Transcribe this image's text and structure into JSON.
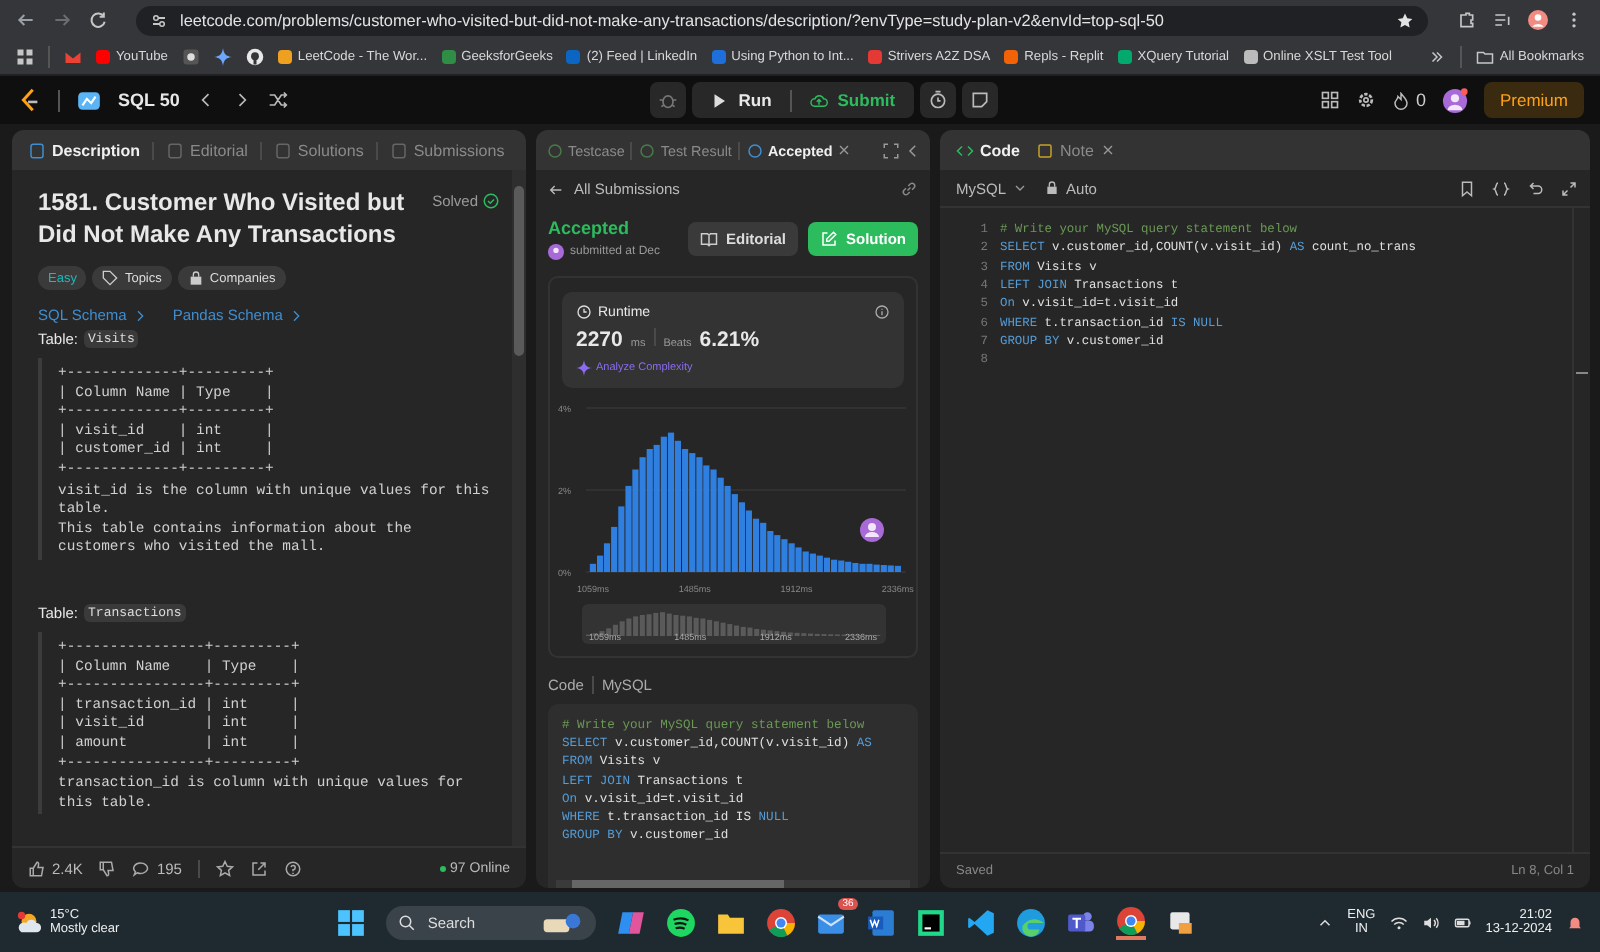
{
  "browser": {
    "url": "leetcode.com/problems/customer-who-visited-but-did-not-make-any-transactions/description/?envType=study-plan-v2&envId=top-sql-50",
    "bookmarks": [
      {
        "label": "YouTube",
        "color": "#ff0000"
      },
      {
        "label": "LeetCode - The Wor...",
        "color": "#f0a020"
      },
      {
        "label": "GeeksforGeeks",
        "color": "#2f8d46"
      },
      {
        "label": "(2) Feed | LinkedIn",
        "color": "#0a66c2"
      },
      {
        "label": "Using Python to Int...",
        "color": "#1e6fd9"
      },
      {
        "label": "Strivers A2Z DSA",
        "color": "#e53935"
      },
      {
        "label": "Repls - Replit",
        "color": "#f26207"
      },
      {
        "label": "XQuery Tutorial",
        "color": "#04aa6d"
      },
      {
        "label": "Online XSLT Test Tool",
        "color": "#bbbbbb"
      }
    ],
    "all_bookmarks": "All Bookmarks"
  },
  "nav": {
    "title": "SQL 50",
    "run": "Run",
    "submit": "Submit",
    "streak": "0",
    "premium": "Premium"
  },
  "left_panel": {
    "tabs": [
      {
        "label": "Description",
        "selected": true
      },
      {
        "label": "Editorial",
        "selected": false
      },
      {
        "label": "Solutions",
        "selected": false
      },
      {
        "label": "Submissions",
        "selected": false
      }
    ],
    "title": "1581. Customer Who Visited but Did Not Make Any Transactions",
    "status": "Solved",
    "tags": [
      {
        "label": "Easy",
        "kind": "difficulty"
      },
      {
        "label": "Topics",
        "kind": "topics"
      },
      {
        "label": "Companies",
        "kind": "companies"
      }
    ],
    "links": [
      "SQL Schema",
      "Pandas Schema"
    ],
    "schemas": [
      {
        "label": "Table:",
        "table": "Visits",
        "rows": [
          "+-------------+---------+",
          "| Column Name | Type    |",
          "+-------------+---------+",
          "| visit_id    | int     |",
          "| customer_id | int     |",
          "+-------------+---------+"
        ],
        "notes": [
          "visit_id is the column with unique values for this",
          "table.",
          "This table contains information about the",
          "customers who visited the mall."
        ]
      },
      {
        "label": "Table:",
        "table": "Transactions",
        "rows": [
          "+----------------+---------+",
          "| Column Name    | Type    |",
          "+----------------+---------+",
          "| transaction_id | int     |",
          "| visit_id       | int     |",
          "| amount         | int     |",
          "+----------------+---------+"
        ],
        "notes": [
          "transaction_id is column with unique values for",
          "this table."
        ]
      }
    ],
    "likes": "2.4K",
    "comments": "195",
    "online": "97 Online"
  },
  "middle_panel": {
    "tabs": [
      {
        "label": "Testcase",
        "selected": false,
        "closable": false
      },
      {
        "label": "Test Result",
        "selected": false,
        "closable": false
      },
      {
        "label": "Accepted",
        "selected": true,
        "closable": true
      }
    ],
    "back": "All Submissions",
    "verdict": "Accepted",
    "submitted": "submitted at Dec",
    "editorial": "Editorial",
    "solution": "Solution",
    "runtime": {
      "title": "Runtime",
      "value": "2270",
      "unit": "ms",
      "beats_label": "Beats",
      "beats": "6.21%",
      "analyze": "Analyze Complexity"
    },
    "chart_data": {
      "type": "bar",
      "color": "#2f7fe0",
      "x": [
        1059,
        1089,
        1118,
        1148,
        1178,
        1208,
        1237,
        1267,
        1297,
        1326,
        1356,
        1386,
        1415,
        1445,
        1475,
        1505,
        1534,
        1564,
        1594,
        1623,
        1653,
        1683,
        1712,
        1742,
        1772,
        1802,
        1831,
        1861,
        1891,
        1920,
        1950,
        1980,
        2009,
        2039,
        2069,
        2099,
        2128,
        2158,
        2188,
        2217,
        2247,
        2277,
        2306,
        2336
      ],
      "values": [
        0.2,
        0.4,
        0.7,
        1.1,
        1.6,
        2.1,
        2.5,
        2.8,
        3.0,
        3.1,
        3.3,
        3.4,
        3.2,
        3.0,
        2.9,
        2.8,
        2.6,
        2.5,
        2.3,
        2.1,
        1.9,
        1.7,
        1.5,
        1.3,
        1.2,
        1.0,
        0.9,
        0.8,
        0.7,
        0.6,
        0.5,
        0.45,
        0.4,
        0.35,
        0.3,
        0.28,
        0.25,
        0.22,
        0.2,
        0.2,
        0.18,
        0.17,
        0.16,
        0.15
      ],
      "xlim": [
        1030,
        2370
      ],
      "ylim": [
        0,
        4
      ],
      "xticks": [
        {
          "value": 1059,
          "label": "1059ms"
        },
        {
          "value": 1485,
          "label": "1485ms"
        },
        {
          "value": 1912,
          "label": "1912ms"
        },
        {
          "value": 2336,
          "label": "2336ms"
        }
      ],
      "yticks": [
        {
          "value": 0,
          "label": "0%"
        },
        {
          "value": 2,
          "label": "2%"
        },
        {
          "value": 4,
          "label": "4%"
        }
      ]
    },
    "brush_labels": [
      "1059ms",
      "1485ms",
      "1912ms",
      "2336ms"
    ],
    "code_label": "Code",
    "language": "MySQL",
    "code": [
      [
        {
          "text": "# Write your MySQL query statement below",
          "kind": "comment"
        }
      ],
      [
        {
          "text": "SELECT",
          "kind": "keyword"
        },
        {
          "text": " v.customer_id,COUNT(v.visit_id) ",
          "kind": "plain"
        },
        {
          "text": "AS",
          "kind": "keyword"
        }
      ],
      [
        {
          "text": "FROM",
          "kind": "keyword"
        },
        {
          "text": " Visits v",
          "kind": "plain"
        }
      ],
      [
        {
          "text": "LEFT JOIN",
          "kind": "keyword"
        },
        {
          "text": " Transactions t",
          "kind": "plain"
        }
      ],
      [
        {
          "text": "On",
          "kind": "keyword"
        },
        {
          "text": " v.visit_id=t.visit_id",
          "kind": "plain"
        }
      ],
      [
        {
          "text": "WHERE",
          "kind": "keyword"
        },
        {
          "text": " t.transaction_id IS ",
          "kind": "plain"
        },
        {
          "text": "NULL",
          "kind": "keyword"
        }
      ],
      [
        {
          "text": "GROUP BY",
          "kind": "keyword"
        },
        {
          "text": " v.customer_id",
          "kind": "plain"
        }
      ]
    ]
  },
  "editor": {
    "tabs": [
      {
        "label": "Code",
        "selected": true,
        "closable": false
      },
      {
        "label": "Note",
        "selected": false,
        "closable": true
      }
    ],
    "language": "MySQL",
    "mode": "Auto",
    "lines": [
      {
        "num": "1",
        "tokens": [
          {
            "text": "# Write your MySQL query statement below",
            "kind": "comment"
          }
        ]
      },
      {
        "num": "2",
        "tokens": [
          {
            "text": "SELECT",
            "kind": "keyword"
          },
          {
            "text": " v.customer_id,COUNT(v.visit_id) ",
            "kind": "plain"
          },
          {
            "text": "AS",
            "kind": "keyword"
          },
          {
            "text": " count_no_trans",
            "kind": "plain"
          }
        ]
      },
      {
        "num": "3",
        "tokens": [
          {
            "text": "FROM",
            "kind": "keyword"
          },
          {
            "text": " Visits v",
            "kind": "plain"
          }
        ]
      },
      {
        "num": "4",
        "tokens": [
          {
            "text": "LEFT JOIN",
            "kind": "keyword"
          },
          {
            "text": " Transactions t",
            "kind": "plain"
          }
        ]
      },
      {
        "num": "5",
        "tokens": [
          {
            "text": "On",
            "kind": "keyword"
          },
          {
            "text": " v.visit_id=t.visit_id",
            "kind": "plain"
          }
        ]
      },
      {
        "num": "6",
        "tokens": [
          {
            "text": "WHERE",
            "kind": "keyword"
          },
          {
            "text": " t.transaction_id ",
            "kind": "plain"
          },
          {
            "text": "IS NULL",
            "kind": "keyword"
          }
        ]
      },
      {
        "num": "7",
        "tokens": [
          {
            "text": "GROUP BY",
            "kind": "keyword"
          },
          {
            "text": " v.customer_id",
            "kind": "plain"
          }
        ]
      },
      {
        "num": "8"
      }
    ],
    "status": "Saved",
    "cursor": "Ln 8, Col 1"
  },
  "taskbar": {
    "temperature": "15°C",
    "weather": "Mostly clear",
    "search": "Search",
    "mail_badge": "36",
    "lang": "ENG",
    "region": "IN",
    "time": "21:02",
    "date": "13-12-2024"
  }
}
